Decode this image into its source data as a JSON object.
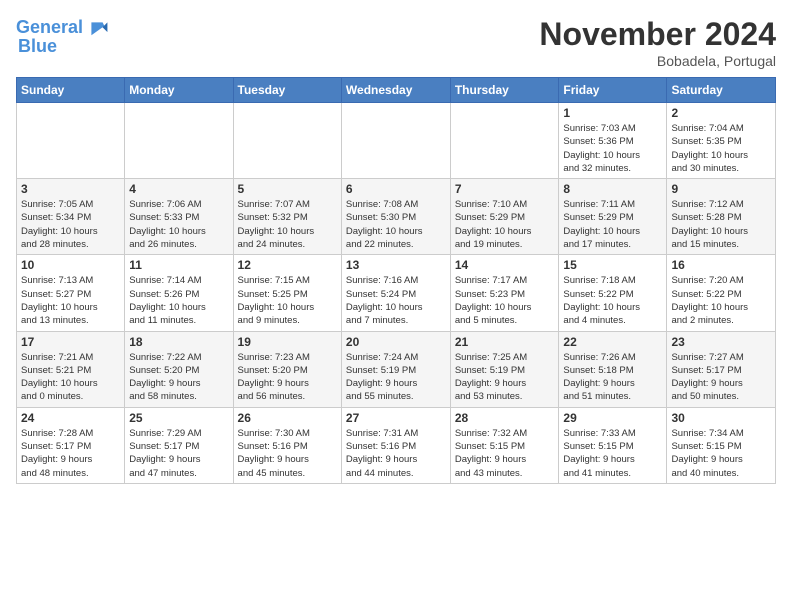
{
  "header": {
    "logo_line1": "General",
    "logo_line2": "Blue",
    "month": "November 2024",
    "location": "Bobadela, Portugal"
  },
  "days_of_week": [
    "Sunday",
    "Monday",
    "Tuesday",
    "Wednesday",
    "Thursday",
    "Friday",
    "Saturday"
  ],
  "weeks": [
    [
      {
        "day": "",
        "info": ""
      },
      {
        "day": "",
        "info": ""
      },
      {
        "day": "",
        "info": ""
      },
      {
        "day": "",
        "info": ""
      },
      {
        "day": "",
        "info": ""
      },
      {
        "day": "1",
        "info": "Sunrise: 7:03 AM\nSunset: 5:36 PM\nDaylight: 10 hours\nand 32 minutes."
      },
      {
        "day": "2",
        "info": "Sunrise: 7:04 AM\nSunset: 5:35 PM\nDaylight: 10 hours\nand 30 minutes."
      }
    ],
    [
      {
        "day": "3",
        "info": "Sunrise: 7:05 AM\nSunset: 5:34 PM\nDaylight: 10 hours\nand 28 minutes."
      },
      {
        "day": "4",
        "info": "Sunrise: 7:06 AM\nSunset: 5:33 PM\nDaylight: 10 hours\nand 26 minutes."
      },
      {
        "day": "5",
        "info": "Sunrise: 7:07 AM\nSunset: 5:32 PM\nDaylight: 10 hours\nand 24 minutes."
      },
      {
        "day": "6",
        "info": "Sunrise: 7:08 AM\nSunset: 5:30 PM\nDaylight: 10 hours\nand 22 minutes."
      },
      {
        "day": "7",
        "info": "Sunrise: 7:10 AM\nSunset: 5:29 PM\nDaylight: 10 hours\nand 19 minutes."
      },
      {
        "day": "8",
        "info": "Sunrise: 7:11 AM\nSunset: 5:29 PM\nDaylight: 10 hours\nand 17 minutes."
      },
      {
        "day": "9",
        "info": "Sunrise: 7:12 AM\nSunset: 5:28 PM\nDaylight: 10 hours\nand 15 minutes."
      }
    ],
    [
      {
        "day": "10",
        "info": "Sunrise: 7:13 AM\nSunset: 5:27 PM\nDaylight: 10 hours\nand 13 minutes."
      },
      {
        "day": "11",
        "info": "Sunrise: 7:14 AM\nSunset: 5:26 PM\nDaylight: 10 hours\nand 11 minutes."
      },
      {
        "day": "12",
        "info": "Sunrise: 7:15 AM\nSunset: 5:25 PM\nDaylight: 10 hours\nand 9 minutes."
      },
      {
        "day": "13",
        "info": "Sunrise: 7:16 AM\nSunset: 5:24 PM\nDaylight: 10 hours\nand 7 minutes."
      },
      {
        "day": "14",
        "info": "Sunrise: 7:17 AM\nSunset: 5:23 PM\nDaylight: 10 hours\nand 5 minutes."
      },
      {
        "day": "15",
        "info": "Sunrise: 7:18 AM\nSunset: 5:22 PM\nDaylight: 10 hours\nand 4 minutes."
      },
      {
        "day": "16",
        "info": "Sunrise: 7:20 AM\nSunset: 5:22 PM\nDaylight: 10 hours\nand 2 minutes."
      }
    ],
    [
      {
        "day": "17",
        "info": "Sunrise: 7:21 AM\nSunset: 5:21 PM\nDaylight: 10 hours\nand 0 minutes."
      },
      {
        "day": "18",
        "info": "Sunrise: 7:22 AM\nSunset: 5:20 PM\nDaylight: 9 hours\nand 58 minutes."
      },
      {
        "day": "19",
        "info": "Sunrise: 7:23 AM\nSunset: 5:20 PM\nDaylight: 9 hours\nand 56 minutes."
      },
      {
        "day": "20",
        "info": "Sunrise: 7:24 AM\nSunset: 5:19 PM\nDaylight: 9 hours\nand 55 minutes."
      },
      {
        "day": "21",
        "info": "Sunrise: 7:25 AM\nSunset: 5:19 PM\nDaylight: 9 hours\nand 53 minutes."
      },
      {
        "day": "22",
        "info": "Sunrise: 7:26 AM\nSunset: 5:18 PM\nDaylight: 9 hours\nand 51 minutes."
      },
      {
        "day": "23",
        "info": "Sunrise: 7:27 AM\nSunset: 5:17 PM\nDaylight: 9 hours\nand 50 minutes."
      }
    ],
    [
      {
        "day": "24",
        "info": "Sunrise: 7:28 AM\nSunset: 5:17 PM\nDaylight: 9 hours\nand 48 minutes."
      },
      {
        "day": "25",
        "info": "Sunrise: 7:29 AM\nSunset: 5:17 PM\nDaylight: 9 hours\nand 47 minutes."
      },
      {
        "day": "26",
        "info": "Sunrise: 7:30 AM\nSunset: 5:16 PM\nDaylight: 9 hours\nand 45 minutes."
      },
      {
        "day": "27",
        "info": "Sunrise: 7:31 AM\nSunset: 5:16 PM\nDaylight: 9 hours\nand 44 minutes."
      },
      {
        "day": "28",
        "info": "Sunrise: 7:32 AM\nSunset: 5:15 PM\nDaylight: 9 hours\nand 43 minutes."
      },
      {
        "day": "29",
        "info": "Sunrise: 7:33 AM\nSunset: 5:15 PM\nDaylight: 9 hours\nand 41 minutes."
      },
      {
        "day": "30",
        "info": "Sunrise: 7:34 AM\nSunset: 5:15 PM\nDaylight: 9 hours\nand 40 minutes."
      }
    ]
  ]
}
